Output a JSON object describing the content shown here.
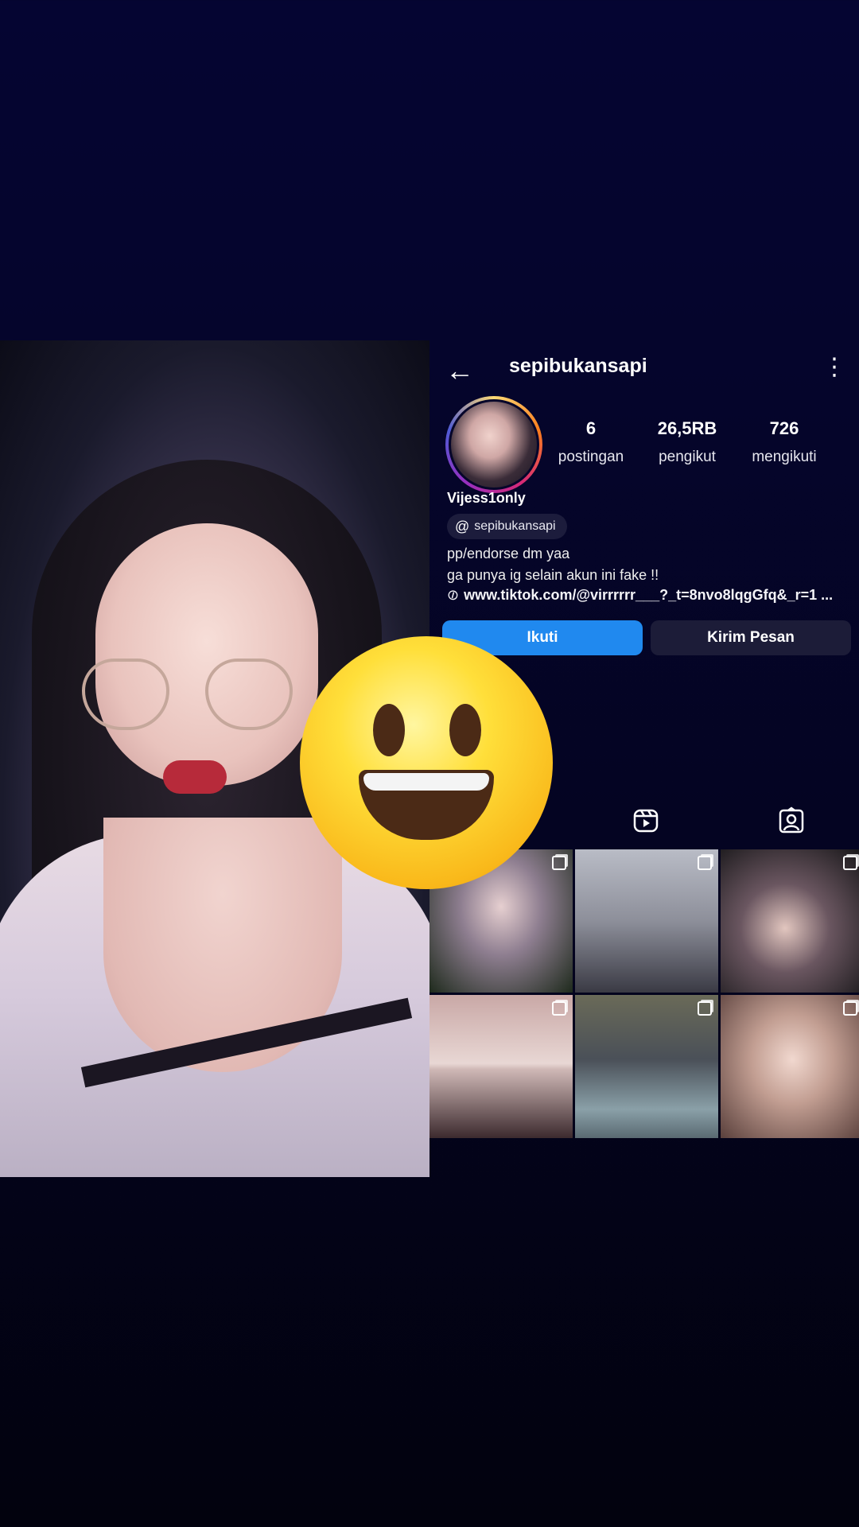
{
  "header": {
    "back_icon": "arrow-left-icon",
    "username": "sepibukansapi",
    "more_icon": "more-vertical-icon"
  },
  "profile": {
    "stats": [
      {
        "value": "6",
        "label": "postingan"
      },
      {
        "value": "26,5RB",
        "label": "pengikut"
      },
      {
        "value": "726",
        "label": "mengikuti"
      }
    ],
    "fullname": "Vijess1only",
    "threads_handle": "sepibukansapi",
    "bio_lines": [
      "pp/endorse dm yaa",
      "ga punya ig selain akun ini fake !!"
    ],
    "link": "www.tiktok.com/@virrrrrr___?_t=8nvo8lqgGfq&_r=1 ..."
  },
  "actions": {
    "follow_label": "Ikuti",
    "message_label": "Kirim Pesan"
  },
  "tabs": [
    "reels-icon",
    "tagged-icon"
  ],
  "grid": {
    "tiles": 6,
    "multi_icon": "multiple-posts-icon"
  },
  "colors": {
    "background": "#05052a",
    "follow_button": "#2089ef",
    "message_button": "#1c1c38"
  }
}
